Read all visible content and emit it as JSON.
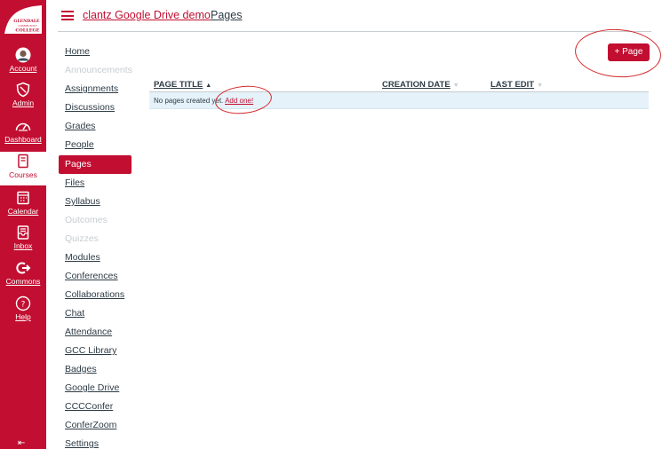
{
  "global_nav": {
    "logo_line1": "GLENDALE",
    "logo_line2": "COMMUNITY",
    "logo_line3": "COLLEGE",
    "items": [
      {
        "label": "Account",
        "icon": "avatar-icon"
      },
      {
        "label": "Admin",
        "icon": "shield-icon"
      },
      {
        "label": "Dashboard",
        "icon": "dashboard-gauge-icon"
      },
      {
        "label": "Courses",
        "icon": "book-icon",
        "active": true
      },
      {
        "label": "Calendar",
        "icon": "calendar-icon"
      },
      {
        "label": "Inbox",
        "icon": "inbox-icon"
      },
      {
        "label": "Commons",
        "icon": "commons-arrow-icon"
      },
      {
        "label": "Help",
        "icon": "help-circle-icon"
      }
    ],
    "collapse_icon": "collapse-arrow-icon"
  },
  "header": {
    "course_name": "clantz Google Drive demo",
    "separator": "›",
    "current_page": "Pages"
  },
  "course_nav": {
    "items": [
      {
        "label": "Home",
        "state": "normal"
      },
      {
        "label": "Announcements",
        "state": "disabled"
      },
      {
        "label": "Assignments",
        "state": "normal"
      },
      {
        "label": "Discussions",
        "state": "normal"
      },
      {
        "label": "Grades",
        "state": "normal"
      },
      {
        "label": "People",
        "state": "normal"
      },
      {
        "label": "Pages",
        "state": "active"
      },
      {
        "label": "Files",
        "state": "normal"
      },
      {
        "label": "Syllabus",
        "state": "normal"
      },
      {
        "label": "Outcomes",
        "state": "disabled"
      },
      {
        "label": "Quizzes",
        "state": "disabled"
      },
      {
        "label": "Modules",
        "state": "normal"
      },
      {
        "label": "Conferences",
        "state": "normal"
      },
      {
        "label": "Collaborations",
        "state": "normal"
      },
      {
        "label": "Chat",
        "state": "normal"
      },
      {
        "label": "Attendance",
        "state": "normal"
      },
      {
        "label": "GCC Library",
        "state": "normal"
      },
      {
        "label": "Badges",
        "state": "normal"
      },
      {
        "label": "Google Drive",
        "state": "normal"
      },
      {
        "label": "CCCConfer",
        "state": "normal"
      },
      {
        "label": "ConferZoom",
        "state": "normal"
      },
      {
        "label": "Settings",
        "state": "normal"
      }
    ]
  },
  "main": {
    "new_page_button": "+ Page",
    "table": {
      "columns": [
        {
          "label": "PAGE TITLE",
          "sort_icon": "sort-asc-icon",
          "sort_glyph": "▲"
        },
        {
          "label": "CREATION DATE",
          "sort_icon": "sort-icon",
          "sort_glyph": "▼"
        },
        {
          "label": "LAST EDIT",
          "sort_icon": "sort-icon",
          "sort_glyph": "▼"
        }
      ],
      "empty_message": "No pages created yet.",
      "add_link": "Add one!"
    }
  },
  "colors": {
    "brand": "#c20e31",
    "annotation": "#d4272a",
    "row_highlight": "#e6f2f9"
  }
}
